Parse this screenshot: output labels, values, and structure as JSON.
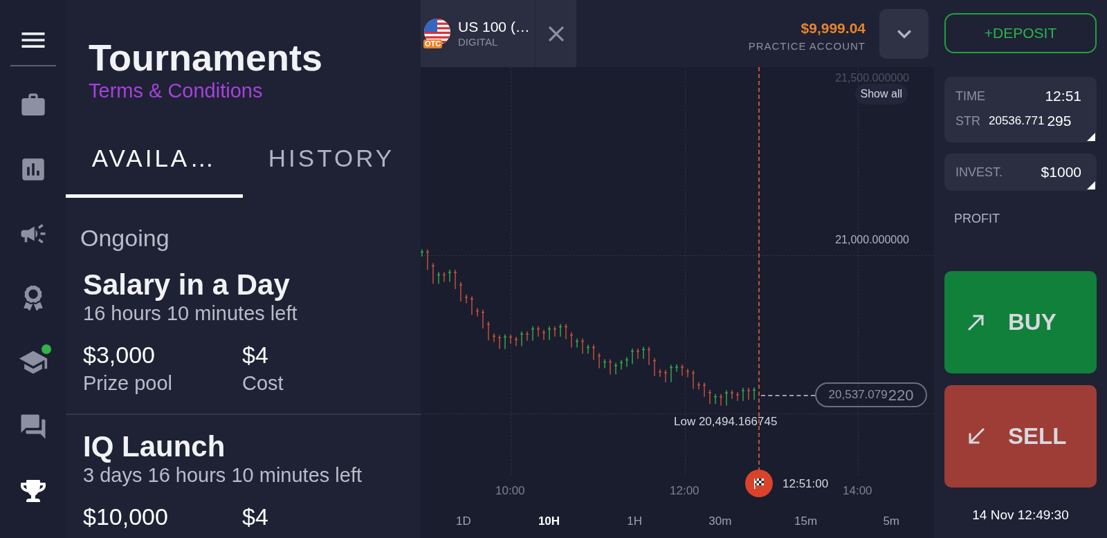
{
  "sidebar": {
    "items": [
      {
        "kind": "menu",
        "selected": false,
        "notification": false
      },
      {
        "kind": "portfolio",
        "selected": false,
        "notification": false
      },
      {
        "kind": "market",
        "selected": false,
        "notification": false
      },
      {
        "kind": "promo",
        "selected": false,
        "notification": false
      },
      {
        "kind": "awards",
        "selected": false,
        "notification": false
      },
      {
        "kind": "education",
        "selected": false,
        "notification": true
      },
      {
        "kind": "chat",
        "selected": false,
        "notification": false
      },
      {
        "kind": "tournaments",
        "selected": true,
        "notification": false
      }
    ]
  },
  "panel": {
    "title": "Tournaments",
    "link": "Terms & Conditions",
    "tabs": [
      {
        "label": "AVAILA…",
        "selected": true
      },
      {
        "label": "HISTORY",
        "selected": false
      }
    ],
    "section": "Ongoing",
    "tournaments": [
      {
        "name": "Salary in a Day",
        "time_left": "16 hours 10 minutes left",
        "prize": "$3,000",
        "prize_label": "Prize pool",
        "cost": "$4",
        "cost_label": "Cost"
      },
      {
        "name": "IQ Launch",
        "time_left": "3 days 16 hours 10 minutes left",
        "prize": "$10,000",
        "cost": "$4"
      }
    ]
  },
  "asset": {
    "name": "US 100 (…",
    "type": "DIGITAL",
    "badge": "OTC"
  },
  "account": {
    "balance": "$9,999.04",
    "label": "PRACTICE ACCOUNT"
  },
  "deposit": "+DEPOSIT",
  "chart": {
    "price_labels": [
      "21,500.000000",
      "21,000.000000"
    ],
    "show_all": "Show all",
    "current_price": "20,537.079",
    "current_price_tail": "220",
    "low": "Low 20,494.166745",
    "time_labels": [
      "10:00",
      "12:00",
      "14:00"
    ],
    "expiry": "12:51:00",
    "timeframes": [
      {
        "label": "1D",
        "selected": false
      },
      {
        "label": "10H",
        "selected": true
      },
      {
        "label": "1H",
        "selected": false
      },
      {
        "label": "30m",
        "selected": false
      },
      {
        "label": "15m",
        "selected": false
      },
      {
        "label": "5m",
        "selected": false
      }
    ]
  },
  "trade": {
    "time_label": "TIME",
    "time": "12:51",
    "strike_label": "STR",
    "strike": "20536.771",
    "strike_tail": "295",
    "invest_label": "INVEST.",
    "invest": "$1000",
    "profit_label": "PROFIT",
    "buttons": [
      {
        "kind": "buy",
        "label": "BUY"
      },
      {
        "kind": "sell",
        "label": "SELL"
      }
    ]
  },
  "clock": "14 Nov 12:49:30"
}
